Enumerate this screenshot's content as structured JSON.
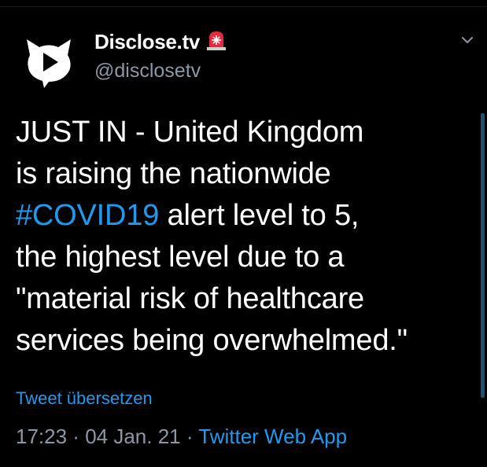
{
  "author": {
    "display_name": "Disclose.tv",
    "handle": "@disclosetv",
    "badge_icon": "siren-icon"
  },
  "tweet": {
    "lines": [
      "JUST IN - United Kingdom",
      "is raising the nationwide",
      "alert level to 5,",
      "the highest level due to a",
      "\"material risk of healthcare",
      "services being overwhelmed.\""
    ],
    "hashtag": "#COVID19"
  },
  "translate_label": "Tweet übersetzen",
  "meta": {
    "time": "17:23",
    "separator": " · ",
    "date": "04 Jan. 21",
    "source": "Twitter Web App"
  },
  "colors": {
    "background": "#000000",
    "text": "#ffffff",
    "secondary": "#8b98a5",
    "link": "#1d9bf0",
    "siren": "#e8283c"
  }
}
